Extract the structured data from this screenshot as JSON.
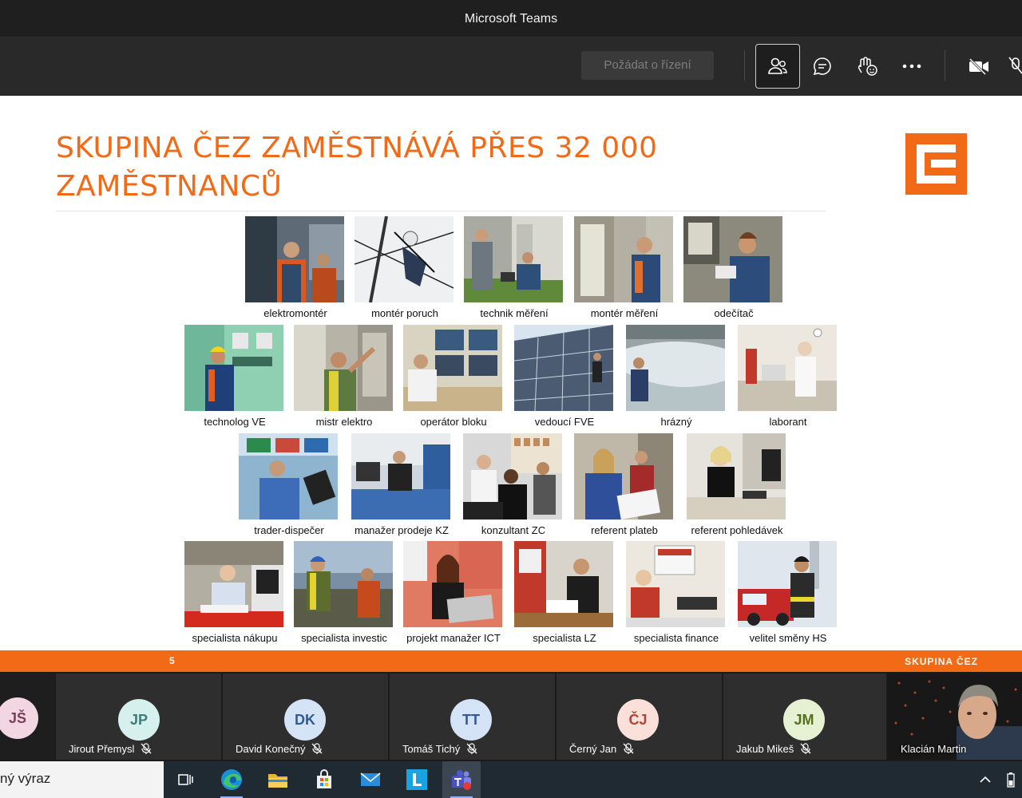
{
  "window": {
    "title": "Microsoft Teams"
  },
  "toolbar": {
    "request_control_label": "Požádat o řízení",
    "icons": [
      "participants-icon",
      "chat-icon",
      "reactions-icon",
      "more-icon",
      "camera-off-icon",
      "mic-off-icon"
    ]
  },
  "slide": {
    "title_line1": "SKUPINA ČEZ ZAMĚSTNÁVÁ PŘES 32 000",
    "title_line2": "ZAMĚSTNANCŮ",
    "page_number": "5",
    "brand": "SKUPINA ČEZ",
    "accent_color": "#f26a16",
    "rows": [
      [
        "elektromontér",
        "montér poruch",
        "technik měření",
        "montér měření",
        "odečítač"
      ],
      [
        "technolog VE",
        "mistr elektro",
        "operátor bloku",
        "vedoucí FVE",
        "hrázný",
        "laborant"
      ],
      [
        "trader-dispečer",
        "manažer prodeje KZ",
        "konzultant ZC",
        "referent plateb",
        "referent pohledávek"
      ],
      [
        "specialista nákupu",
        "specialista investic",
        "projekt manažer ICT",
        "specialista LZ",
        "specialista finance",
        "velitel směny HS"
      ]
    ]
  },
  "participants": [
    {
      "initials": "JŠ",
      "name": ""
    },
    {
      "initials": "JP",
      "name": "Jirout Přemysl"
    },
    {
      "initials": "DK",
      "name": "David Konečný"
    },
    {
      "initials": "TT",
      "name": "Tomáš Tichý"
    },
    {
      "initials": "ČJ",
      "name": "Černý Jan"
    },
    {
      "initials": "JM",
      "name": "Jakub Mikeš"
    },
    {
      "initials": "",
      "name": "Klacián Martin"
    }
  ],
  "taskbar": {
    "search_text": "ný výraz",
    "apps": [
      "task-view-icon",
      "edge-icon",
      "file-explorer-icon",
      "store-icon",
      "mail-icon",
      "l-app-icon",
      "teams-icon"
    ]
  }
}
